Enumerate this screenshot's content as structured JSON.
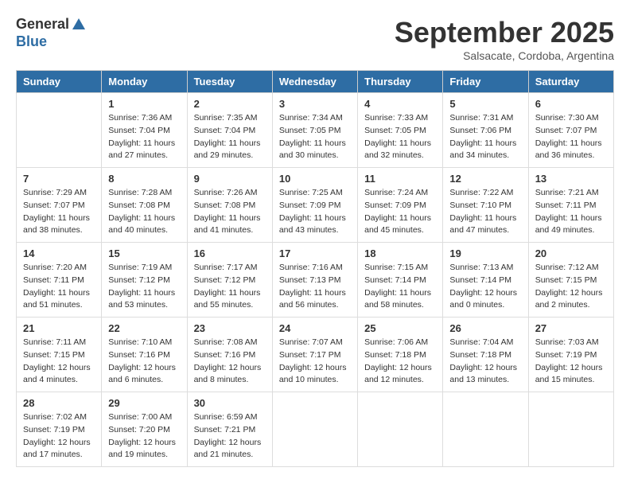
{
  "header": {
    "logo_line1": "General",
    "logo_line2": "Blue",
    "month_title": "September 2025",
    "location": "Salsacate, Cordoba, Argentina"
  },
  "days_of_week": [
    "Sunday",
    "Monday",
    "Tuesday",
    "Wednesday",
    "Thursday",
    "Friday",
    "Saturday"
  ],
  "weeks": [
    [
      {
        "day": "",
        "info": ""
      },
      {
        "day": "1",
        "info": "Sunrise: 7:36 AM\nSunset: 7:04 PM\nDaylight: 11 hours\nand 27 minutes."
      },
      {
        "day": "2",
        "info": "Sunrise: 7:35 AM\nSunset: 7:04 PM\nDaylight: 11 hours\nand 29 minutes."
      },
      {
        "day": "3",
        "info": "Sunrise: 7:34 AM\nSunset: 7:05 PM\nDaylight: 11 hours\nand 30 minutes."
      },
      {
        "day": "4",
        "info": "Sunrise: 7:33 AM\nSunset: 7:05 PM\nDaylight: 11 hours\nand 32 minutes."
      },
      {
        "day": "5",
        "info": "Sunrise: 7:31 AM\nSunset: 7:06 PM\nDaylight: 11 hours\nand 34 minutes."
      },
      {
        "day": "6",
        "info": "Sunrise: 7:30 AM\nSunset: 7:07 PM\nDaylight: 11 hours\nand 36 minutes."
      }
    ],
    [
      {
        "day": "7",
        "info": "Sunrise: 7:29 AM\nSunset: 7:07 PM\nDaylight: 11 hours\nand 38 minutes."
      },
      {
        "day": "8",
        "info": "Sunrise: 7:28 AM\nSunset: 7:08 PM\nDaylight: 11 hours\nand 40 minutes."
      },
      {
        "day": "9",
        "info": "Sunrise: 7:26 AM\nSunset: 7:08 PM\nDaylight: 11 hours\nand 41 minutes."
      },
      {
        "day": "10",
        "info": "Sunrise: 7:25 AM\nSunset: 7:09 PM\nDaylight: 11 hours\nand 43 minutes."
      },
      {
        "day": "11",
        "info": "Sunrise: 7:24 AM\nSunset: 7:09 PM\nDaylight: 11 hours\nand 45 minutes."
      },
      {
        "day": "12",
        "info": "Sunrise: 7:22 AM\nSunset: 7:10 PM\nDaylight: 11 hours\nand 47 minutes."
      },
      {
        "day": "13",
        "info": "Sunrise: 7:21 AM\nSunset: 7:11 PM\nDaylight: 11 hours\nand 49 minutes."
      }
    ],
    [
      {
        "day": "14",
        "info": "Sunrise: 7:20 AM\nSunset: 7:11 PM\nDaylight: 11 hours\nand 51 minutes."
      },
      {
        "day": "15",
        "info": "Sunrise: 7:19 AM\nSunset: 7:12 PM\nDaylight: 11 hours\nand 53 minutes."
      },
      {
        "day": "16",
        "info": "Sunrise: 7:17 AM\nSunset: 7:12 PM\nDaylight: 11 hours\nand 55 minutes."
      },
      {
        "day": "17",
        "info": "Sunrise: 7:16 AM\nSunset: 7:13 PM\nDaylight: 11 hours\nand 56 minutes."
      },
      {
        "day": "18",
        "info": "Sunrise: 7:15 AM\nSunset: 7:14 PM\nDaylight: 11 hours\nand 58 minutes."
      },
      {
        "day": "19",
        "info": "Sunrise: 7:13 AM\nSunset: 7:14 PM\nDaylight: 12 hours\nand 0 minutes."
      },
      {
        "day": "20",
        "info": "Sunrise: 7:12 AM\nSunset: 7:15 PM\nDaylight: 12 hours\nand 2 minutes."
      }
    ],
    [
      {
        "day": "21",
        "info": "Sunrise: 7:11 AM\nSunset: 7:15 PM\nDaylight: 12 hours\nand 4 minutes."
      },
      {
        "day": "22",
        "info": "Sunrise: 7:10 AM\nSunset: 7:16 PM\nDaylight: 12 hours\nand 6 minutes."
      },
      {
        "day": "23",
        "info": "Sunrise: 7:08 AM\nSunset: 7:16 PM\nDaylight: 12 hours\nand 8 minutes."
      },
      {
        "day": "24",
        "info": "Sunrise: 7:07 AM\nSunset: 7:17 PM\nDaylight: 12 hours\nand 10 minutes."
      },
      {
        "day": "25",
        "info": "Sunrise: 7:06 AM\nSunset: 7:18 PM\nDaylight: 12 hours\nand 12 minutes."
      },
      {
        "day": "26",
        "info": "Sunrise: 7:04 AM\nSunset: 7:18 PM\nDaylight: 12 hours\nand 13 minutes."
      },
      {
        "day": "27",
        "info": "Sunrise: 7:03 AM\nSunset: 7:19 PM\nDaylight: 12 hours\nand 15 minutes."
      }
    ],
    [
      {
        "day": "28",
        "info": "Sunrise: 7:02 AM\nSunset: 7:19 PM\nDaylight: 12 hours\nand 17 minutes."
      },
      {
        "day": "29",
        "info": "Sunrise: 7:00 AM\nSunset: 7:20 PM\nDaylight: 12 hours\nand 19 minutes."
      },
      {
        "day": "30",
        "info": "Sunrise: 6:59 AM\nSunset: 7:21 PM\nDaylight: 12 hours\nand 21 minutes."
      },
      {
        "day": "",
        "info": ""
      },
      {
        "day": "",
        "info": ""
      },
      {
        "day": "",
        "info": ""
      },
      {
        "day": "",
        "info": ""
      }
    ]
  ]
}
